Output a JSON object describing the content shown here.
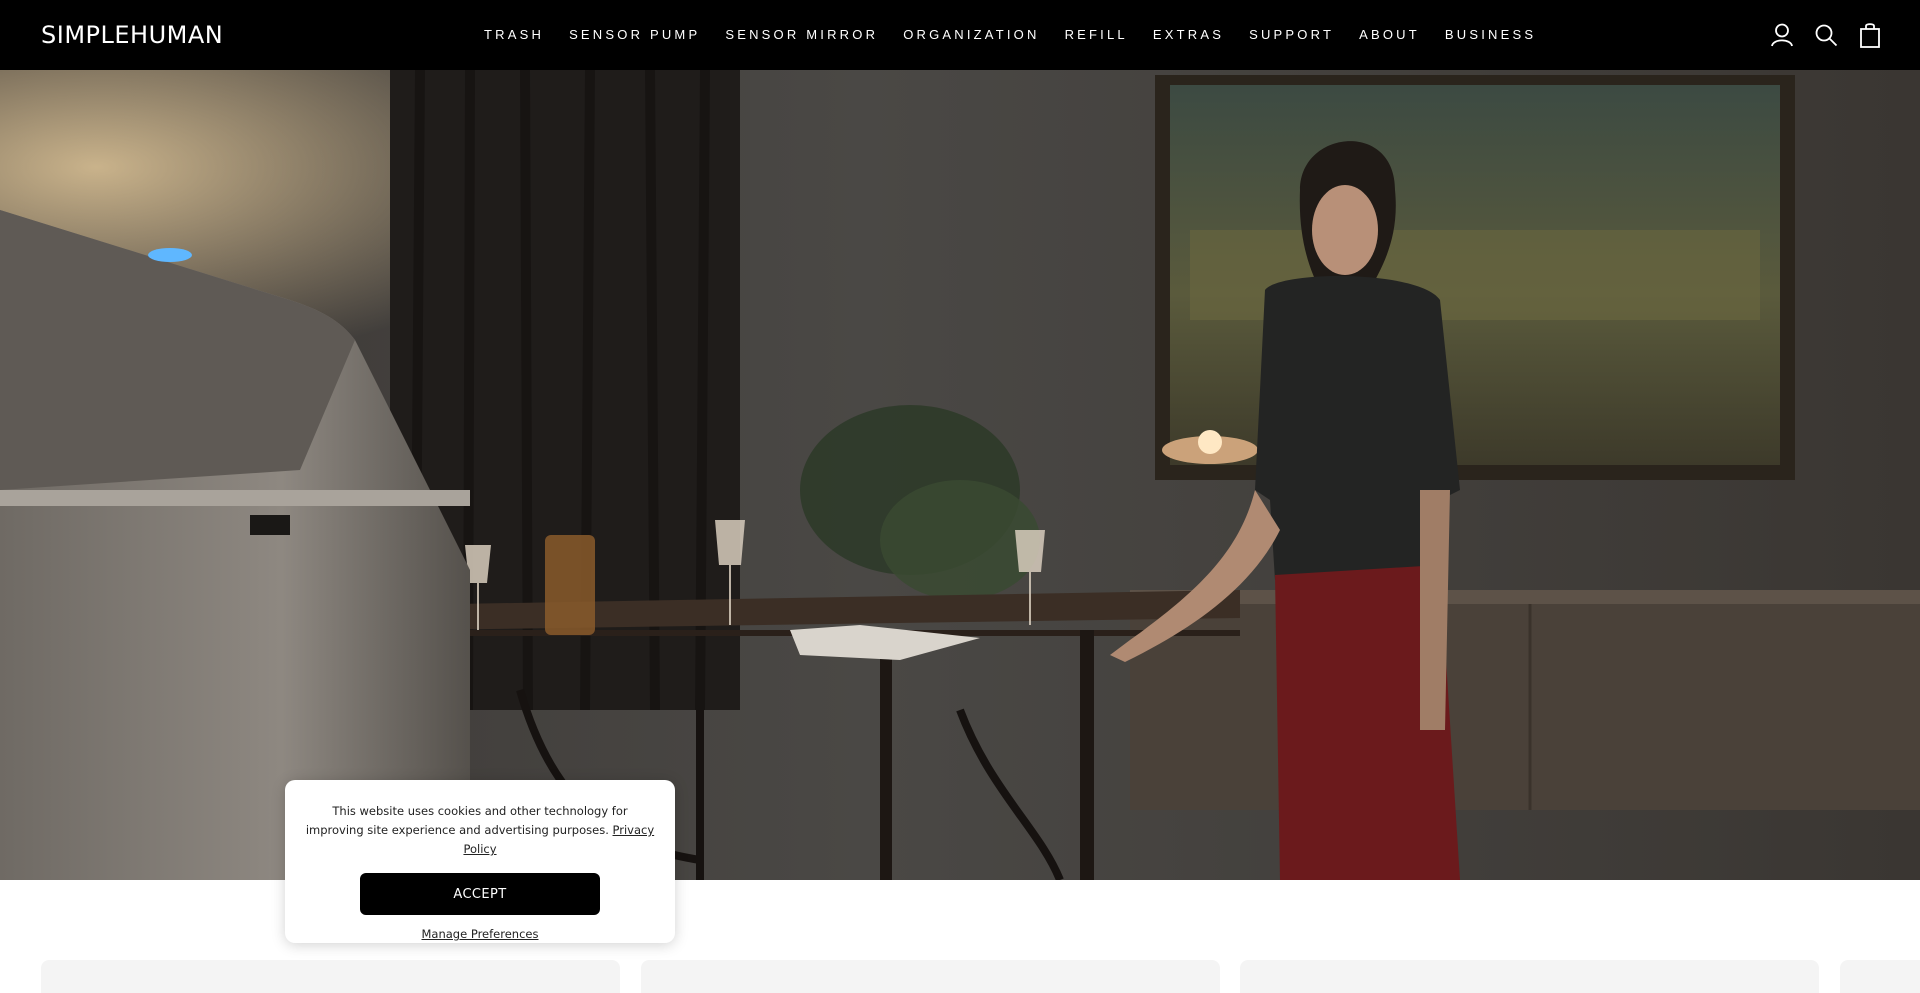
{
  "brand": {
    "logo": "SIMPLEHUMAN"
  },
  "nav": {
    "items": [
      "TRASH",
      "SENSOR PUMP",
      "SENSOR MIRROR",
      "ORGANIZATION",
      "REFILL",
      "EXTRAS",
      "SUPPORT",
      "ABOUT",
      "BUSINESS"
    ]
  },
  "header_icons": [
    "account-icon",
    "search-icon",
    "cart-icon"
  ],
  "cookie": {
    "text": "This website uses cookies and other technology for improving site experience and advertising purposes.",
    "privacy_link": "Privacy Policy",
    "accept_label": "ACCEPT",
    "manage_label": "Manage Preferences"
  },
  "colors": {
    "header_bg": "#000000",
    "accept_bg": "#000000",
    "page_bg": "#ffffff"
  }
}
